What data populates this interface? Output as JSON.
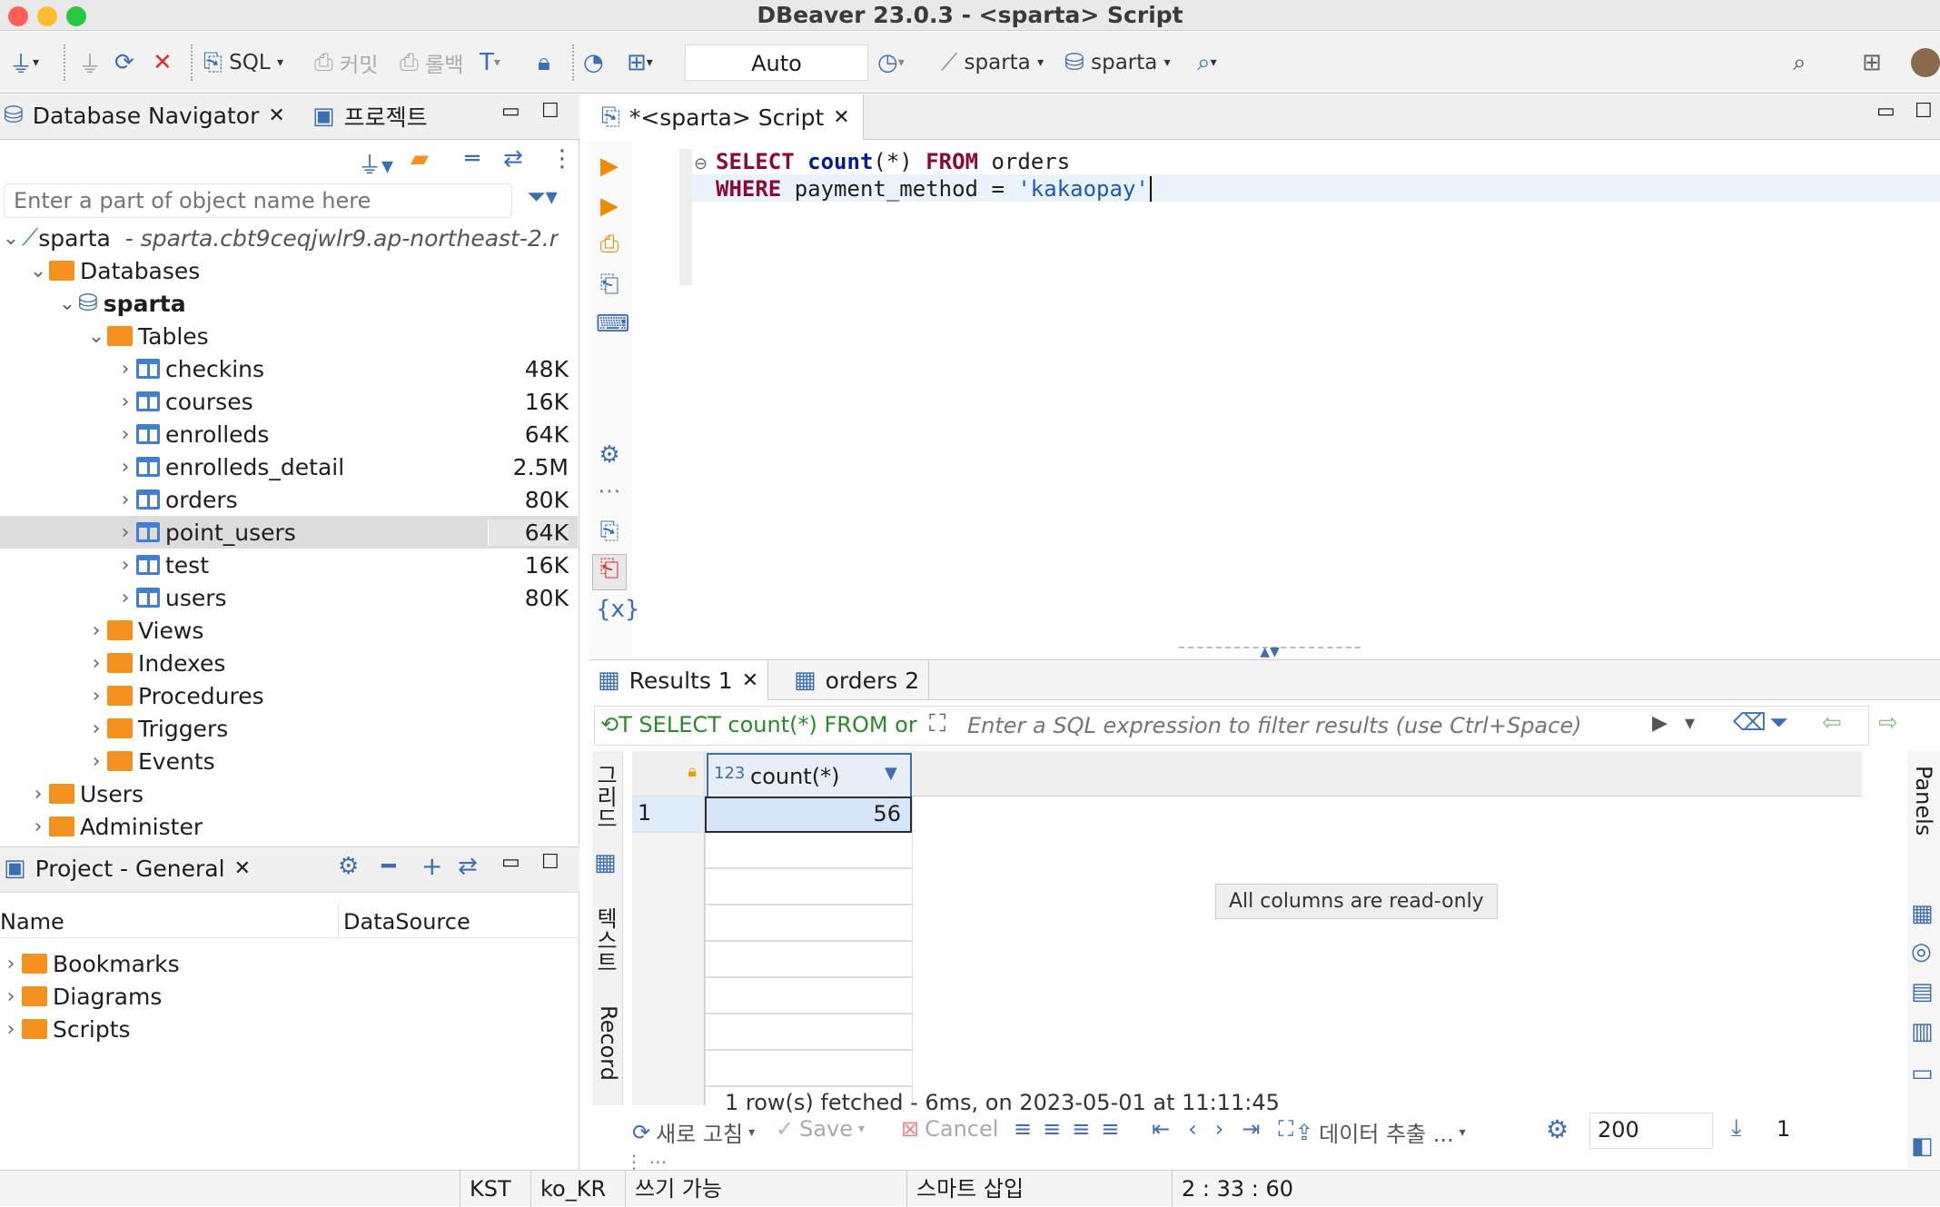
{
  "window": {
    "title": "DBeaver 23.0.3 - <sparta> Script"
  },
  "toolbar": {
    "sql": "SQL",
    "commit": "커밋",
    "rollback": "롤백",
    "mode": "Auto",
    "connection": "sparta",
    "database": "sparta"
  },
  "navigator": {
    "tab_label": "Database Navigator",
    "project_tab": "프로젝트",
    "filter_placeholder": "Enter a part of object name here",
    "connection": {
      "name": "sparta",
      "host": "- sparta.cbt9ceqjwlr9.ap-northeast-2.r"
    },
    "databases": "Databases",
    "db": "sparta",
    "tables_label": "Tables",
    "tables": [
      {
        "name": "checkins",
        "size": "48K"
      },
      {
        "name": "courses",
        "size": "16K"
      },
      {
        "name": "enrolleds",
        "size": "64K"
      },
      {
        "name": "enrolleds_detail",
        "size": "2.5M"
      },
      {
        "name": "orders",
        "size": "80K"
      },
      {
        "name": "point_users",
        "size": "64K"
      },
      {
        "name": "test",
        "size": "16K"
      },
      {
        "name": "users",
        "size": "80K"
      }
    ],
    "other": [
      "Views",
      "Indexes",
      "Procedures",
      "Triggers",
      "Events"
    ],
    "users": "Users",
    "administer": "Administer"
  },
  "project": {
    "tab_label": "Project - General",
    "col_name": "Name",
    "col_ds": "DataSource",
    "items": [
      "Bookmarks",
      "Diagrams",
      "Scripts"
    ]
  },
  "editor": {
    "tab_label": "*<sparta> Script",
    "line1": {
      "k1": "SELECT",
      "f": "count",
      "p": "(*)",
      "k2": "FROM",
      "t": "orders"
    },
    "line2": {
      "k": "WHERE",
      "c": "payment_method = ",
      "s": "'kakaopay'"
    }
  },
  "results": {
    "tab1": "Results 1",
    "tab2": "orders 2",
    "query": "SELECT count(*) FROM or",
    "filter_placeholder": "Enter a SQL expression to filter results (use Ctrl+Space)",
    "column": {
      "type": "123",
      "name": "count(*)"
    },
    "row_num": "1",
    "value": "56",
    "tooltip": "All columns are read-only",
    "side_grid": "그리드",
    "side_text": "텍스트",
    "side_record": "Record",
    "panels": "Panels",
    "refresh": "새로 고침",
    "save": "Save",
    "cancel": "Cancel",
    "export": "데이터 추출 ...",
    "fetch_size": "200",
    "count": "1",
    "status": "1 row(s) fetched - 6ms, on 2023-05-01 at 11:11:45"
  },
  "statusbar": {
    "tz": "KST",
    "locale": "ko_KR",
    "writable": "쓰기 가능",
    "insert": "스마트 삽입",
    "pos": "2 : 33 : 60"
  },
  "colors": {
    "accent": "#3c6eb4",
    "keyword": "#8b0a33",
    "folder": "#f4921f",
    "selected_row": "#dcdcdc"
  }
}
